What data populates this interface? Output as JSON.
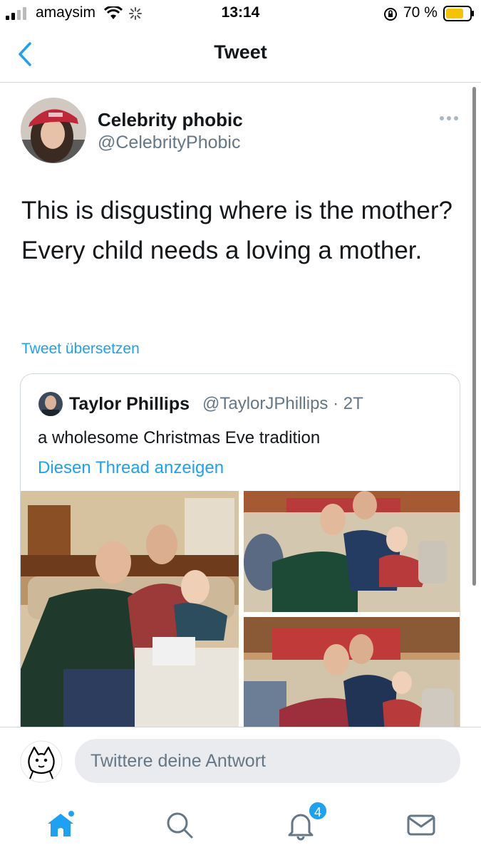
{
  "status_bar": {
    "carrier": "amaysim",
    "time": "13:14",
    "battery_percent": "70 %"
  },
  "nav": {
    "title": "Tweet"
  },
  "tweet": {
    "author_name": "Celebrity phobic",
    "author_handle": "@CelebrityPhobic",
    "text": "This is disgusting where is the mother? Every child needs a loving a mother.",
    "translate_label": "Tweet übersetzen"
  },
  "quoted_tweet": {
    "author_name": "Taylor Phillips",
    "author_handle_time": "@TaylorJPhillips · 2T",
    "text": "a wholesome Christmas Eve tradition",
    "show_thread_label": "Diesen Thread anzeigen"
  },
  "reply": {
    "placeholder": "Twittere deine Antwort"
  },
  "tabs": {
    "notifications_count": "4"
  },
  "colors": {
    "accent": "#1da1f2",
    "secondary_text": "#657786",
    "divider": "#d6d9db"
  }
}
